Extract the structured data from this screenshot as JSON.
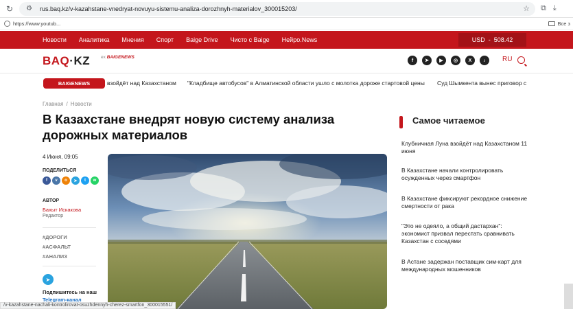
{
  "browser": {
    "url": "rus.baq.kz/v-kazahstane-vnedryat-novuyu-sistemu-analiza-dorozhnyh-materialov_300015203/",
    "bookmark": "https://www.youtub...",
    "bookmarks_right": "Все з"
  },
  "topnav": {
    "items": [
      "Новости",
      "Аналитика",
      "Мнения",
      "Спорт",
      "Baige Drive",
      "Чисто с Baige",
      "Нейро.News"
    ],
    "currency_label": "USD",
    "currency_value": "508.42"
  },
  "header": {
    "logo_a": "BAQ",
    "logo_b": "·KZ",
    "logo_sub_prefix": "ex",
    "logo_sub": "BAIGENEWS",
    "lang": "RU",
    "social_icons": [
      "facebook-icon",
      "telegram-icon",
      "youtube-icon",
      "instagram-icon",
      "x-icon",
      "tiktok-icon"
    ]
  },
  "ticker": {
    "badge": "BAIGENEWS",
    "items": [
      "взойдёт над Казахстаном",
      "\"Кладбище автобусов\" в Алматинской области ушло с молотка дороже стартовой цены",
      "Суд Шымкента вынес приговор с"
    ]
  },
  "breadcrumb": {
    "home": "Главная",
    "section": "Новости"
  },
  "article": {
    "title": "В Казахстане внедрят новую систему анализа дорожных материалов",
    "date": "4 Июня, 09:05",
    "share_label": "ПОДЕЛИТЬСЯ",
    "author_label": "АВТОР",
    "author_name": "Бахыт Искакова",
    "author_role": "Редактор",
    "tags": [
      "#ДОРОГИ",
      "#АСФАЛЬТ",
      "#АНАЛИЗ"
    ],
    "telegram_text": "Подпишитесь на наш",
    "telegram_link": "Telegram-канал"
  },
  "sidebar": {
    "heading": "Самое читаемое",
    "items": [
      "Клубничная Луна взойдёт над Казахстаном 11 июня",
      "В Казахстане начали контролировать осужденных через смартфон",
      "В Казахстане фиксируют рекордное снижение смертности от рака",
      "\"Это не одеяло, а общий дастархан\": экономист призвал перестать сравнивать Казахстан с соседями",
      "В Астане задержан поставщик сим-карт для международных мошенников"
    ]
  },
  "status_bar": "/v-kazahstane-nachali-kontrolirovat-osuzhdennyh-cherez-smartfon_300015551/",
  "colors": {
    "brand": "#c4161c",
    "nav_dark": "#a31217"
  }
}
